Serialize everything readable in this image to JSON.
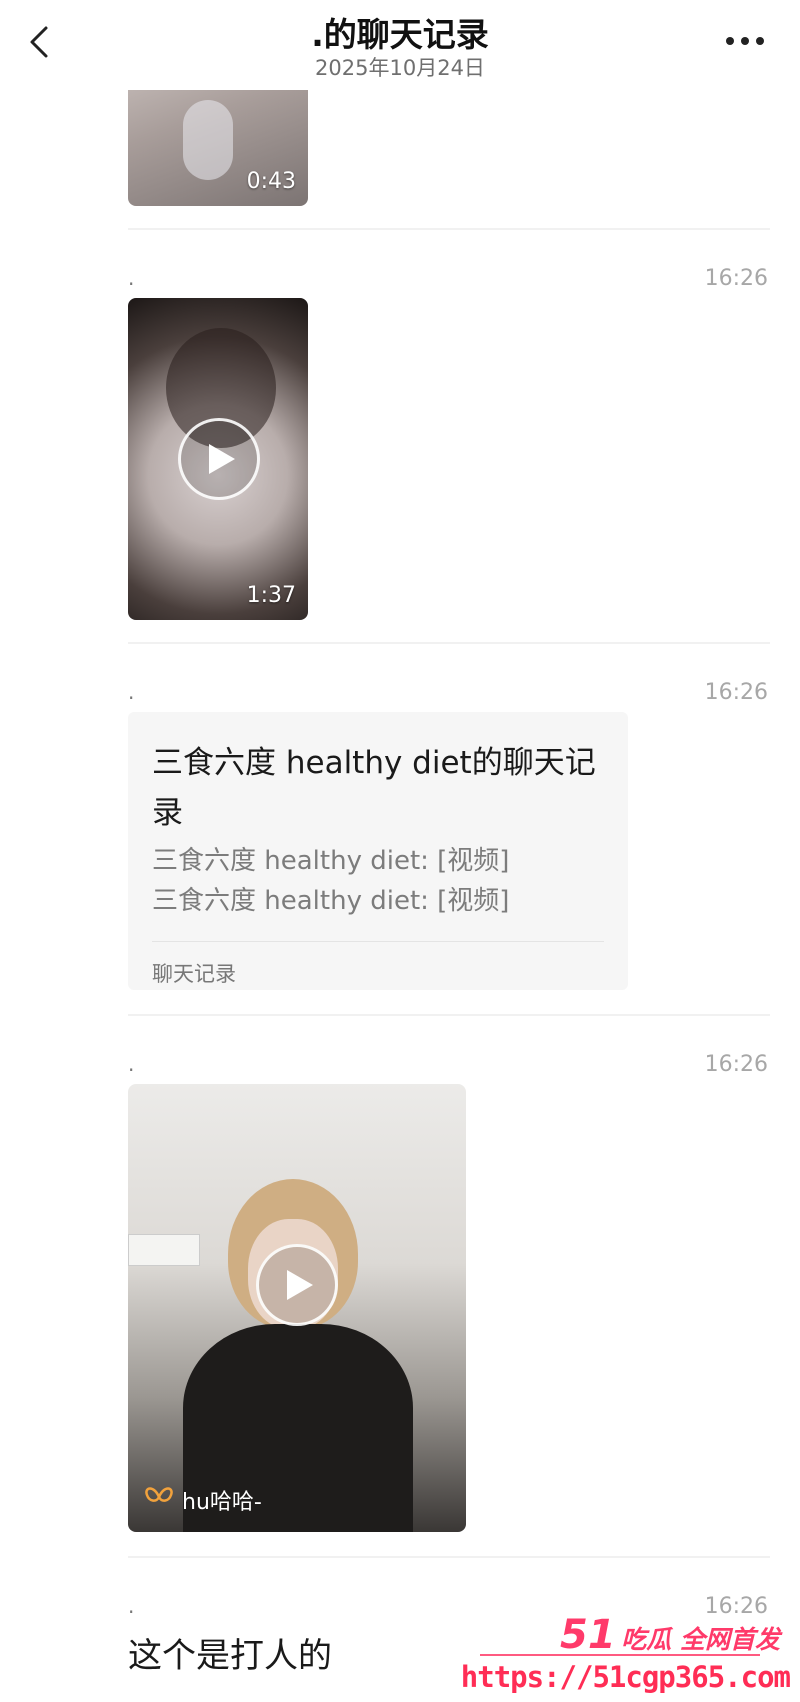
{
  "header": {
    "title": ".的聊天记录",
    "date": "2025年10月24日"
  },
  "messages": [
    {
      "sender": "",
      "time": "",
      "type": "video",
      "duration": "0:43"
    },
    {
      "sender": ".",
      "time": "16:26",
      "type": "video",
      "duration": "1:37"
    },
    {
      "sender": ".",
      "time": "16:26",
      "type": "chat-record",
      "card": {
        "title": "三食六度 healthy diet的聊天记录",
        "lines": [
          "三食六度 healthy diet: [视频]",
          "三食六度 healthy diet: [视频]"
        ],
        "footer": "聊天记录"
      }
    },
    {
      "sender": ".",
      "time": "16:26",
      "type": "video",
      "overlay_user": "hu哈哈-"
    },
    {
      "sender": ".",
      "time": "16:26",
      "type": "text",
      "text": "这个是打人的"
    }
  ],
  "watermark": {
    "brand_number": "51",
    "brand_text": "吃瓜 全网首发",
    "url": "https://51cgp365.com"
  },
  "colors": {
    "background": "#ffffff",
    "timestamp": "#a7a7a7",
    "card_bg": "#f6f6f6",
    "watermark": "#ff2d55"
  },
  "icons": [
    "back-chevron-icon",
    "more-dots-icon",
    "play-icon",
    "butterfly-logo-icon"
  ]
}
